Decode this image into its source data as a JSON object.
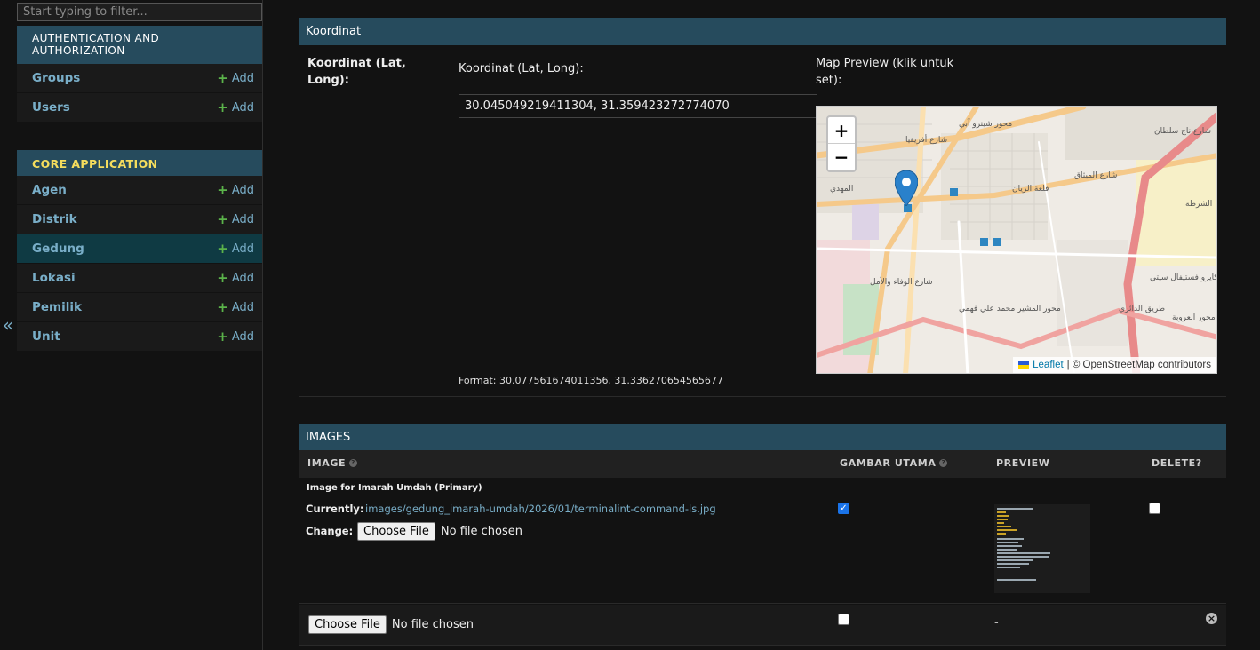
{
  "sidebar": {
    "filter_placeholder": "Start typing to filter...",
    "collapse_glyph": "«",
    "modules": [
      {
        "caption": "AUTHENTICATION AND AUTHORIZATION",
        "models": [
          {
            "name": "Groups",
            "add_label": "Add"
          },
          {
            "name": "Users",
            "add_label": "Add"
          }
        ]
      },
      {
        "caption": "CORE APPLICATION",
        "models": [
          {
            "name": "Agen",
            "add_label": "Add"
          },
          {
            "name": "Distrik",
            "add_label": "Add"
          },
          {
            "name": "Gedung",
            "add_label": "Add",
            "active": true
          },
          {
            "name": "Lokasi",
            "add_label": "Add"
          },
          {
            "name": "Pemilik",
            "add_label": "Add"
          },
          {
            "name": "Unit",
            "add_label": "Add"
          }
        ]
      }
    ]
  },
  "koordinat": {
    "heading": "Koordinat",
    "row_label": "Koordinat (Lat, Long):",
    "input_label": "Koordinat (Lat, Long):",
    "input_value": "30.045049219411304, 31.359423272774070",
    "map_label": "Map Preview (klik untuk set):",
    "help_text": "Format: 30.077561674011356, 31.336270654565677",
    "map": {
      "zoom_in": "+",
      "zoom_out": "−",
      "attribution_leaflet": "Leaflet",
      "attribution_rest": "| © OpenStreetMap contributors",
      "place_labels": [
        "شارع أفريقيا",
        "محور شينزو آبي",
        "قلعة الريان",
        "شارع الميثاق",
        "الشرطة",
        "كايرو فستيفال سيتي",
        "محور المشير محمد علي فهمي",
        "طريق الدائري",
        "المهدي",
        "شارع ناج سلطان",
        "محور العروبة",
        "شارع الوفاء والأمل"
      ]
    }
  },
  "images": {
    "heading": "IMAGES",
    "columns": {
      "image": "IMAGE",
      "gambar_utama": "GAMBAR UTAMA",
      "preview": "PREVIEW",
      "delete": "DELETE?"
    },
    "rows": [
      {
        "object_title": "Image for Imarah Umdah (Primary)",
        "currently_label": "Currently:",
        "current_file": "images/gedung_imarah-umdah/2026/01/terminalint-command-ls.jpg",
        "change_label": "Change:",
        "choose_label": "Choose File",
        "no_file_text": "No file chosen",
        "gambar_utama": true,
        "delete": false
      },
      {
        "choose_label": "Choose File",
        "no_file_text": "No file chosen",
        "gambar_utama": false,
        "preview_placeholder": "-",
        "delete_glyph": "×"
      }
    ]
  }
}
